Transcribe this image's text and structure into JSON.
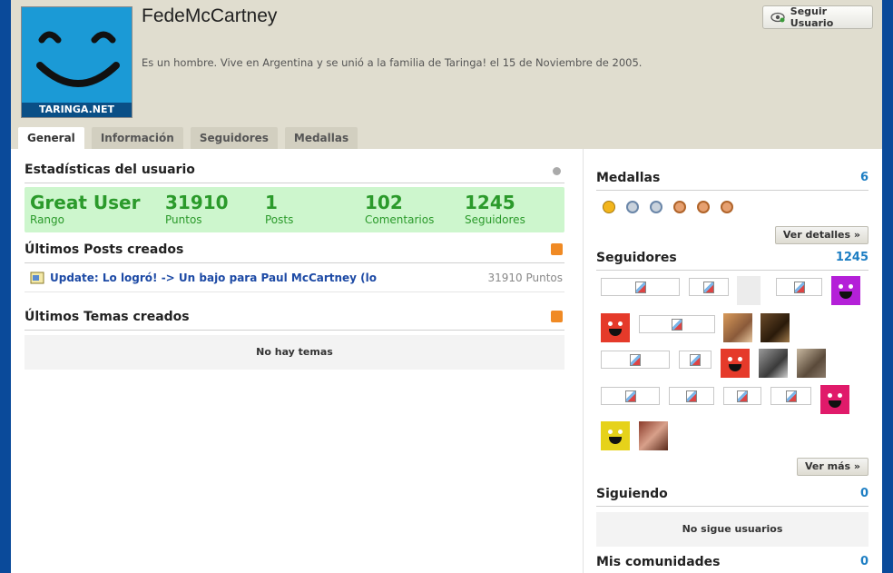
{
  "profile": {
    "username": "FedeMcCartney",
    "bio": "Es un hombre. Vive en Argentina y se unió a la familia de Taringa! el 15 de Noviembre de 2005.",
    "avatar_label": "TARINGA.NET",
    "follow_label": "Seguir Usuario"
  },
  "tabs": [
    {
      "label": "General",
      "active": true
    },
    {
      "label": "Información",
      "active": false
    },
    {
      "label": "Seguidores",
      "active": false
    },
    {
      "label": "Medallas",
      "active": false
    }
  ],
  "stats_section": {
    "title": "Estadísticas del usuario",
    "items": [
      {
        "value": "Great User",
        "label": "Rango"
      },
      {
        "value": "31910",
        "label": "Puntos"
      },
      {
        "value": "1",
        "label": "Posts"
      },
      {
        "value": "102",
        "label": "Comentarios"
      },
      {
        "value": "1245",
        "label": "Seguidores"
      }
    ]
  },
  "posts_section": {
    "title": "Últimos Posts creados",
    "items": [
      {
        "title": "Update: Lo logró! -> Un bajo para Paul McCartney (lo hic",
        "points": "31910 Puntos"
      }
    ]
  },
  "topics_section": {
    "title": "Últimos Temas creados",
    "empty_text": "No hay temas"
  },
  "medals": {
    "title": "Medallas",
    "count": "6",
    "details_label": "Ver detalles »",
    "items": [
      "gold-medal-icon",
      "silver-medal-icon",
      "silver-medal-icon",
      "bronze-medal-icon",
      "bronze-medal-icon",
      "bronze-medal-icon"
    ]
  },
  "followers": {
    "title": "Seguidores",
    "count": "1245",
    "more_label": "Ver más »"
  },
  "following": {
    "title": "Siguiendo",
    "count": "0",
    "empty_text": "No sigue usuarios"
  },
  "communities": {
    "title": "Mis comunidades",
    "count": "0"
  },
  "colors": {
    "accent_green": "#2b9a2b",
    "stats_bg": "#cdf6cd",
    "link_blue": "#1d4aa5",
    "count_blue": "#1d7ec3",
    "header_bg": "#e0ddcf",
    "page_bg": "#0a4a9a"
  }
}
